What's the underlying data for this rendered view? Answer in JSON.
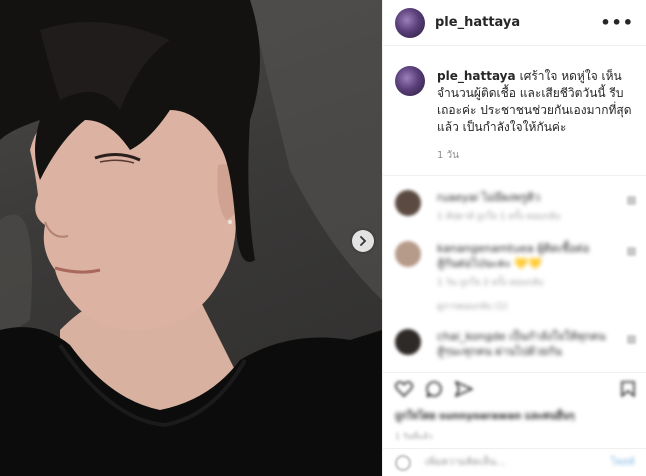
{
  "post": {
    "username": "ple_hattaya",
    "caption": "เศร้าใจ หดหู่ใจ เห็นจำนวนผู้ติดเชื้อ และเสียชีวิตวันนี้ รีบเถอะค่ะ ประชาชนช่วยกันเองมากที่สุดแล้ว เป็นกำลังใจให้กันค่ะ",
    "time": "1 วัน"
  },
  "comments": [
    {
      "text": "ruaeyai ไม่มีผงพรูติว",
      "meta": "1 สัปดาห์  ถูกใจ 1 ครั้ง   ตอบกลับ",
      "avatar_color": "#5b4a42"
    },
    {
      "text": "kanangenamtuea ผู้ติดเชื้อต่อ",
      "text2": "สู้กันต่อไปนะคะ 💛💛",
      "meta": "1 วัน  ถูกใจ 2 ครั้ง   ตอบกลับ",
      "reply": "ดูการตอบกลับ (1)",
      "avatar_color": "#b69a8a"
    },
    {
      "text": "chai_kongde เป็นกำลังใจให้ทุกคน",
      "text2": "สู้ๆนะทุกคน ผ่านไปด้วยกัน",
      "meta": "",
      "avatar_color": "#2e2a28"
    }
  ],
  "actions": {
    "likes": "ถูกใจโดย sunnyoarawan และคนอื่นๆ",
    "posted": "1 วันที่แล้ว",
    "add_comment_placeholder": "เพิ่มความคิดเห็น...",
    "post_label": "โพสต์"
  },
  "colors": {
    "accent": "#0095f6",
    "border": "#efefef",
    "text": "#262626",
    "muted": "#8e8e8e"
  },
  "icons": [
    "more-options-icon",
    "next-arrow-icon",
    "heart-icon",
    "comment-icon",
    "share-icon",
    "bookmark-icon",
    "emoji-icon"
  ]
}
